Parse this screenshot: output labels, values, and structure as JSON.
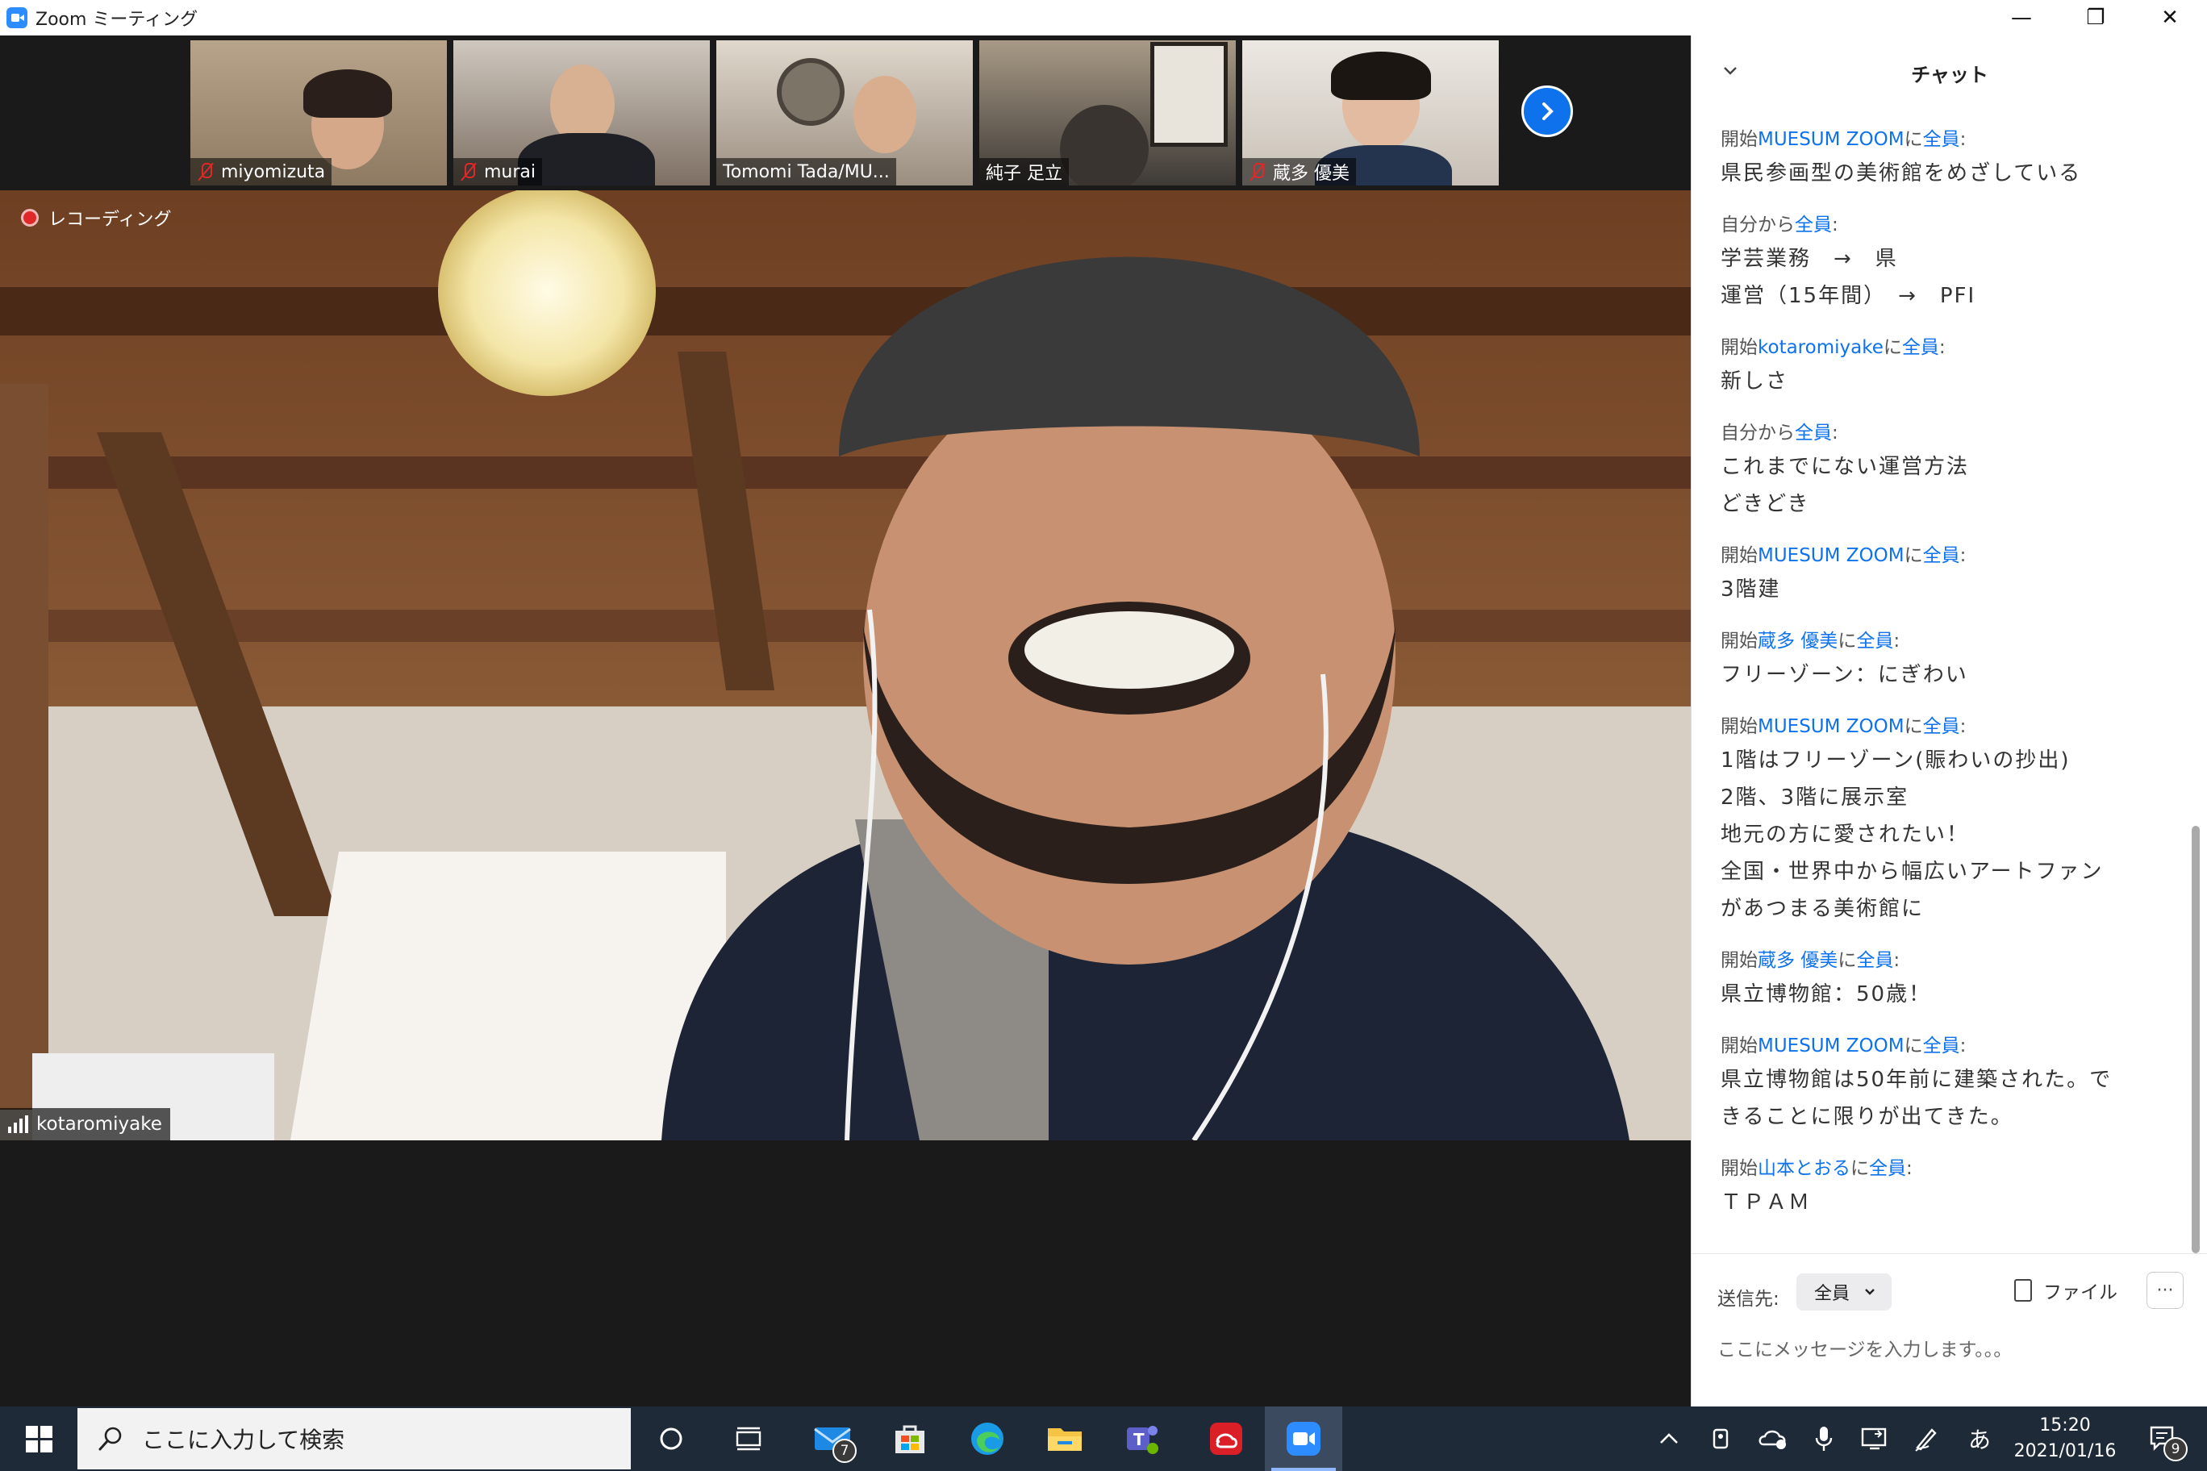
{
  "window": {
    "title": "Zoom ミーティング",
    "minimize_glyph": "—",
    "maximize_glyph": "❐",
    "close_glyph": "✕"
  },
  "participants": [
    {
      "name": "miyomizuta",
      "muted": true
    },
    {
      "name": "murai",
      "muted": true
    },
    {
      "name": "Tomomi Tada/MU...",
      "muted": false
    },
    {
      "name": "純子 足立",
      "muted": false
    },
    {
      "name": "蔵多 優美",
      "muted": true
    }
  ],
  "main_video": {
    "recording_label": "レコーディング",
    "speaker_name": "kotaromiyake"
  },
  "chat": {
    "title": "チャット",
    "messages": [
      {
        "prefix": "開始",
        "sender": "MUESUM ZOOM",
        "mid": "に",
        "recipient": "全員",
        "suffix": ":",
        "lines": [
          "県民参画型の美術館をめざしている"
        ]
      },
      {
        "prefix": "自分から",
        "sender": "",
        "mid": "",
        "recipient": "全員",
        "suffix": ":",
        "lines": [
          "学芸業務　→　県",
          "運営（15年間）　→　PFI"
        ]
      },
      {
        "prefix": "開始",
        "sender": "kotaromiyake",
        "mid": "に",
        "recipient": "全員",
        "suffix": ":",
        "lines": [
          "新しさ"
        ]
      },
      {
        "prefix": "自分から",
        "sender": "",
        "mid": "",
        "recipient": "全員",
        "suffix": ":",
        "lines": [
          "これまでにない運営方法",
          "どきどき"
        ]
      },
      {
        "prefix": "開始",
        "sender": "MUESUM ZOOM",
        "mid": "に",
        "recipient": "全員",
        "suffix": ":",
        "lines": [
          "3階建"
        ]
      },
      {
        "prefix": "開始",
        "sender": "蔵多 優美",
        "mid": "に",
        "recipient": "全員",
        "suffix": ":",
        "lines": [
          "フリーゾーン：にぎわい"
        ]
      },
      {
        "prefix": "開始",
        "sender": "MUESUM ZOOM",
        "mid": "に",
        "recipient": "全員",
        "suffix": ":",
        "lines": [
          "1階はフリーゾーン(賑わいの抄出)",
          "2階、3階に展示室",
          "地元の方に愛されたい！",
          "全国・世界中から幅広いアートファン",
          "があつまる美術館に"
        ]
      },
      {
        "prefix": "開始",
        "sender": "蔵多 優美",
        "mid": "に",
        "recipient": "全員",
        "suffix": ":",
        "lines": [
          "県立博物館：50歳！"
        ]
      },
      {
        "prefix": "開始",
        "sender": "MUESUM ZOOM",
        "mid": "に",
        "recipient": "全員",
        "suffix": ":",
        "lines": [
          "県立博物館は50年前に建築された。で",
          "きることに限りが出てきた。"
        ]
      },
      {
        "prefix": "開始",
        "sender": "山本とおる",
        "mid": "に",
        "recipient": "全員",
        "suffix": ":",
        "lines": [
          "ＴＰＡＭ"
        ]
      }
    ],
    "send_to_label": "送信先:",
    "send_to_value": "全員",
    "file_label": "ファイル",
    "more_label": "···",
    "input_placeholder": "ここにメッセージを入力します。。。"
  },
  "taskbar": {
    "search_placeholder": "ここに入力して検索",
    "mail_badge": "7",
    "notification_badge": "9",
    "ime_label": "あ",
    "time": "15:20",
    "date": "2021/01/16"
  },
  "colors": {
    "accent": "#0e72ed",
    "mute_red": "#e02828",
    "taskbar": "#1f2a38"
  }
}
